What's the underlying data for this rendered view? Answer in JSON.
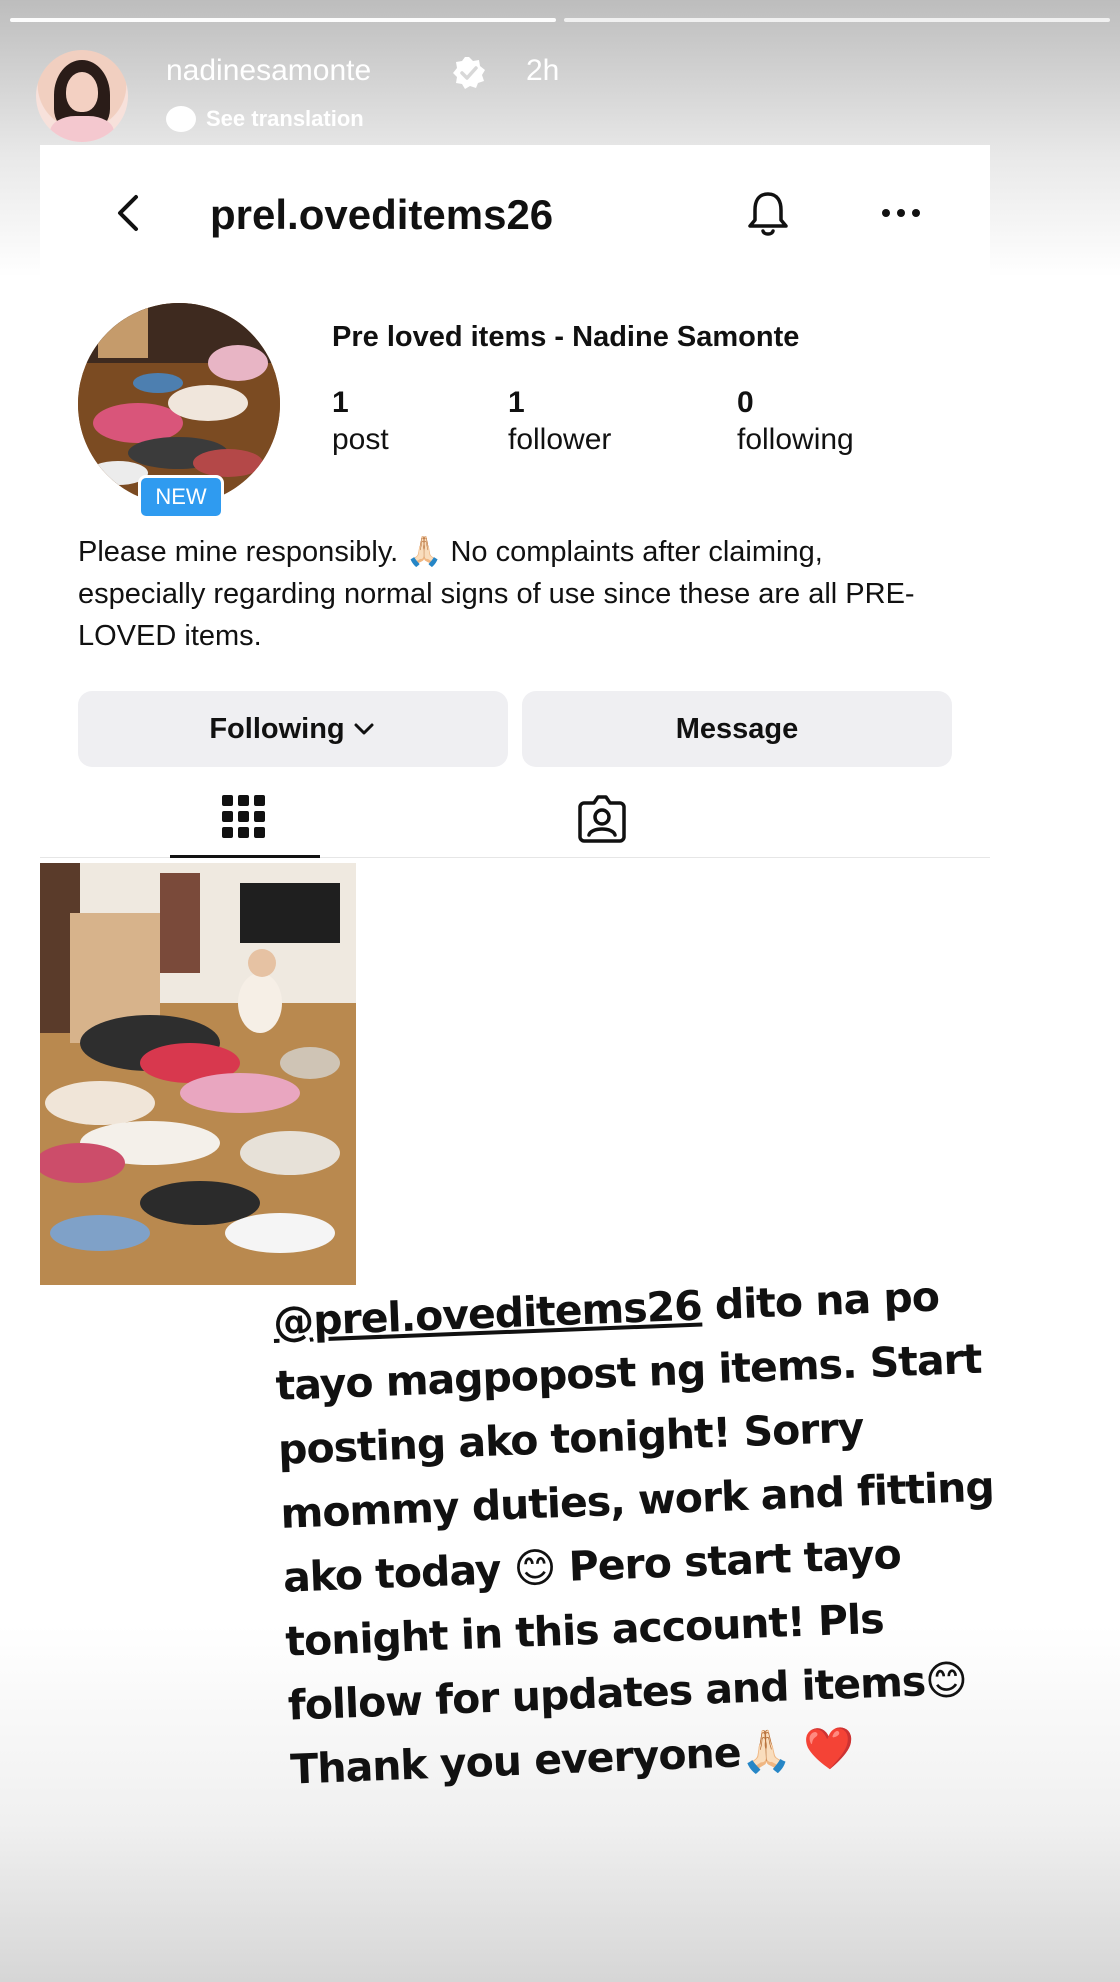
{
  "story": {
    "username": "nadinesamonte",
    "time": "2h",
    "see_translation": "See translation"
  },
  "profile": {
    "handle": "prel.oveditems26",
    "display_name": "Pre loved items - Nadine Samonte",
    "new_badge": "NEW",
    "stats": {
      "posts": {
        "count": "1",
        "label": "post"
      },
      "followers": {
        "count": "1",
        "label": "follower"
      },
      "following": {
        "count": "0",
        "label": "following"
      }
    },
    "bio": "Please mine responsibly. 🙏🏻 No complaints after claiming, especially regarding normal signs of use since these are all PRE-LOVED items.",
    "buttons": {
      "following": "Following",
      "message": "Message"
    },
    "tabs": [
      "posts-grid",
      "tagged"
    ]
  },
  "caption": {
    "mention": "@prel.oveditems26",
    "text": " dito na po tayo magpopost ng items. Start posting ako tonight! Sorry mommy duties, work and fitting ako today 😊 Pero start tayo tonight in this account! Pls follow for updates and items😊 Thank you everyone🙏🏻 ❤️"
  },
  "colors": {
    "new_badge": "#2f9bf0",
    "button_bg": "#efeff2"
  }
}
